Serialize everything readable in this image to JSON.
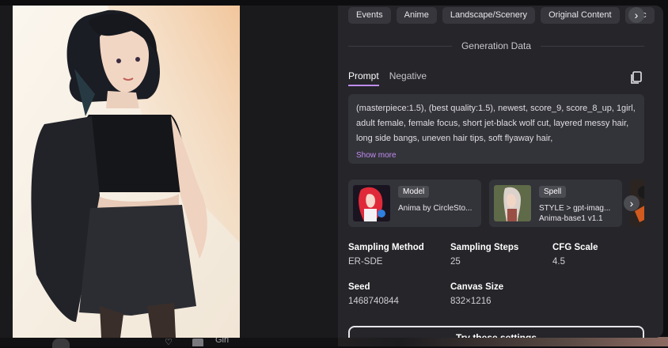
{
  "tags": [
    "Events",
    "Anime",
    "Landscape/Scenery",
    "Original Content",
    "#sc"
  ],
  "tags_next_icon": "chevron-right-icon",
  "generation_heading": "Generation Data",
  "prompt_tabs": {
    "active": "Prompt",
    "inactive": "Negative"
  },
  "copy_icon": "copy-icon",
  "prompt_text": "(masterpiece:1.5), (best quality:1.5), newest, score_9, score_8_up, 1girl, adult female, female focus, short jet-black wolf cut, layered messy hair, long side bangs, uneven hair tips, soft flyaway hair,",
  "show_more": "Show more",
  "resources": [
    {
      "badge": "Model",
      "name": "Anima by CircleSto..."
    },
    {
      "badge": "Spell",
      "name": "STYLE > gpt-imag... Anima-base1 v1.1"
    }
  ],
  "resources_next_icon": "chevron-right-icon",
  "params": {
    "sampling_method": {
      "label": "Sampling Method",
      "value": "ER-SDE"
    },
    "sampling_steps": {
      "label": "Sampling Steps",
      "value": "25"
    },
    "cfg_scale": {
      "label": "CFG Scale",
      "value": "4.5"
    },
    "seed": {
      "label": "Seed",
      "value": "1468740844"
    },
    "canvas_size": {
      "label": "Canvas Size",
      "value": "832×1216"
    }
  },
  "try_button": "Try these settings",
  "background_user": "Girl",
  "colors": {
    "accent": "#c08cf0",
    "panel": "#25252a",
    "card": "#33333a"
  }
}
